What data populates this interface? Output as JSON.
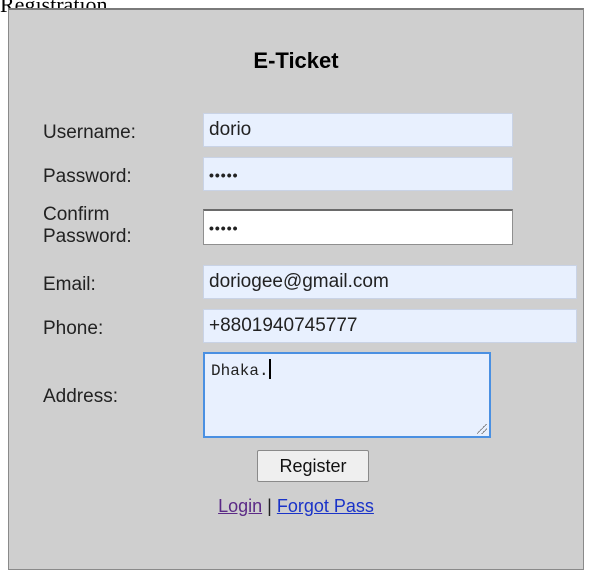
{
  "page_label": "Registration",
  "form": {
    "title": "E-Ticket",
    "fields": {
      "username": {
        "label": "Username:",
        "value": "dorio"
      },
      "password": {
        "label": "Password:",
        "value": "•••••"
      },
      "confirm_password": {
        "label": "Confirm\nPassword:",
        "value": "•••••"
      },
      "email": {
        "label": "Email:",
        "value": "doriogee@gmail.com"
      },
      "phone": {
        "label": "Phone:",
        "value": "+8801940745777"
      },
      "address": {
        "label": "Address:",
        "value": "Dhaka."
      }
    },
    "register_label": "Register",
    "login_link": "Login",
    "separator": "|",
    "forgot_link": "Forgot Pass"
  }
}
